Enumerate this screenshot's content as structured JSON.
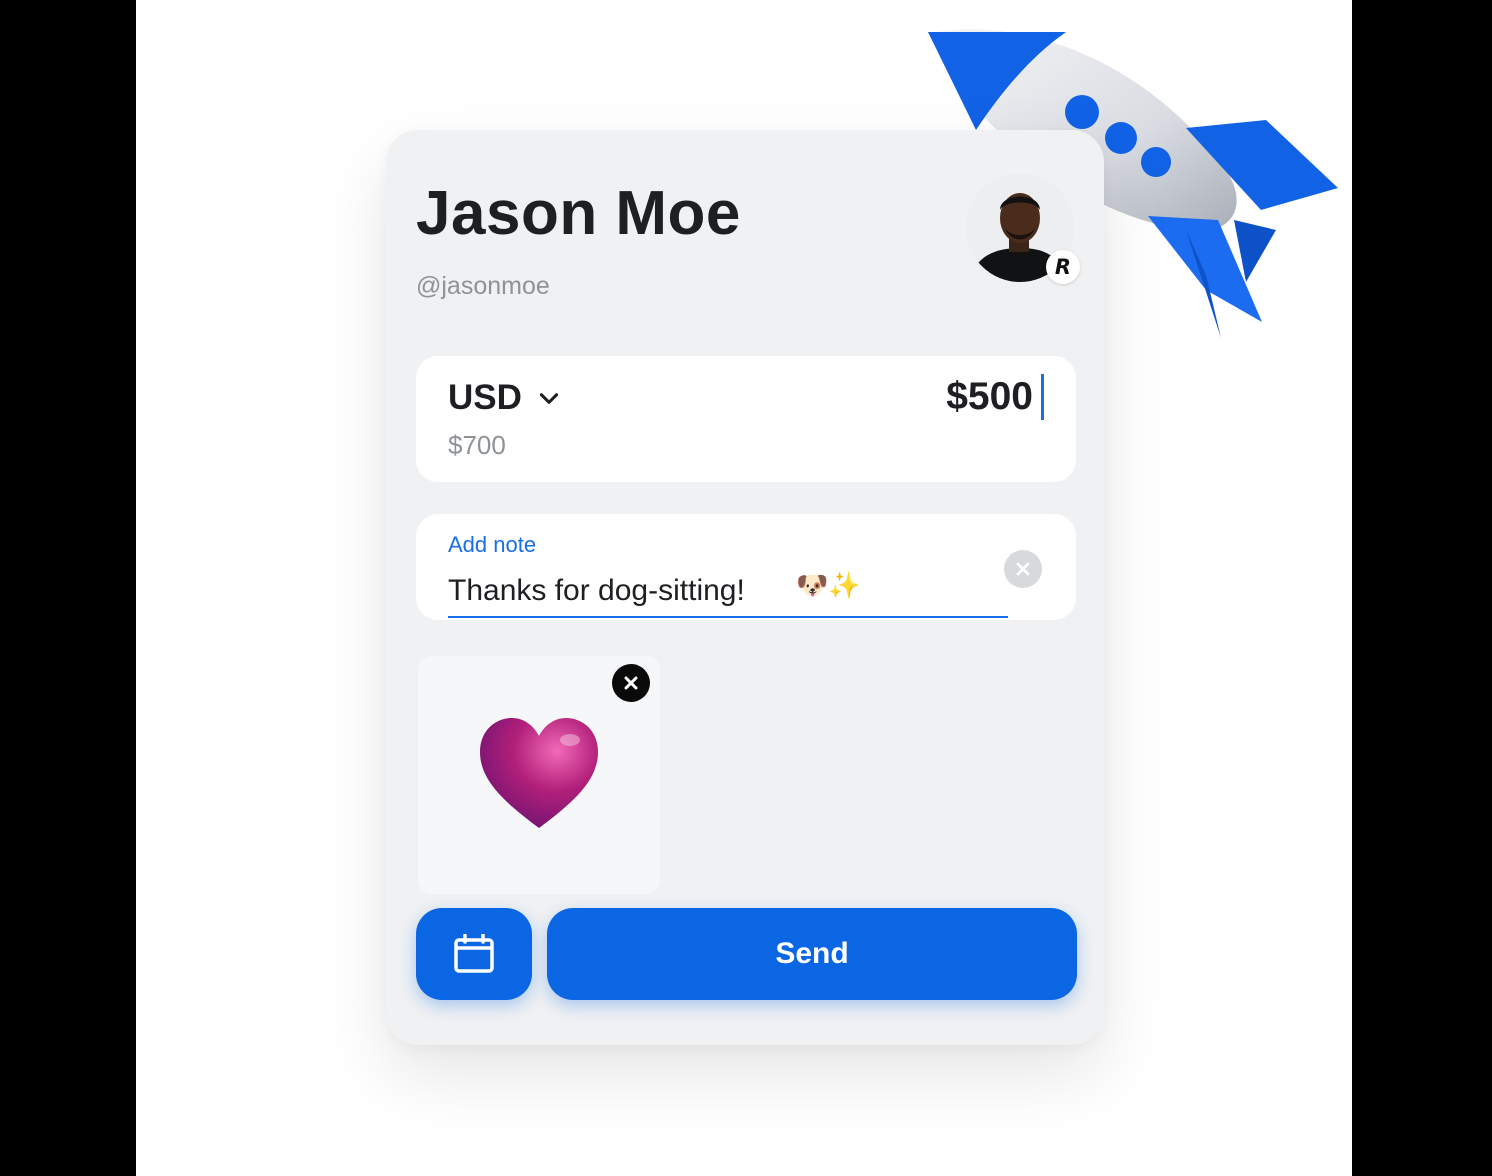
{
  "recipient": {
    "name": "Jason Moe",
    "handle": "@jasonmoe",
    "avatar_badge": "R"
  },
  "transfer": {
    "currency": "USD",
    "amount": "$500",
    "converted_amount": "$700"
  },
  "note": {
    "label": "Add note",
    "value": "Thanks for dog-sitting!",
    "emoji": "🐶✨"
  },
  "attachment": {
    "icon": "heart-icon",
    "color": "#b2207a"
  },
  "actions": {
    "schedule_icon": "calendar-icon",
    "send_label": "Send"
  },
  "decoration": {
    "icon": "rocket-icon"
  },
  "colors": {
    "accent": "#0b66e4",
    "card_background": "#eff1f3"
  }
}
